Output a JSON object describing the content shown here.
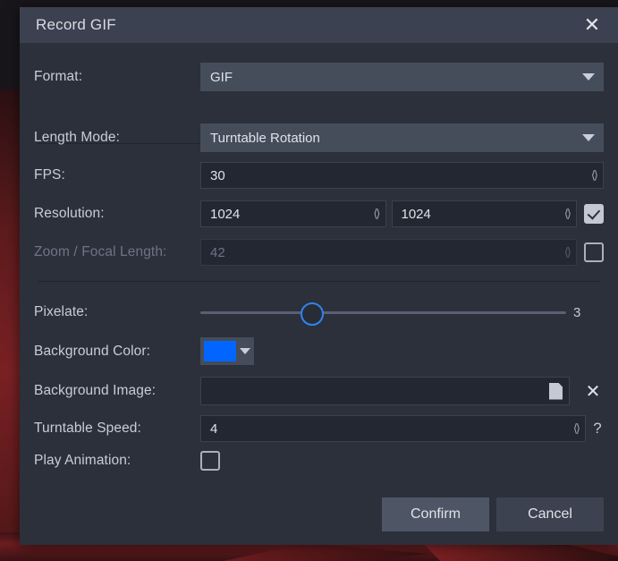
{
  "dialog": {
    "title": "Record GIF",
    "close_icon": "close-icon"
  },
  "rows": {
    "format": {
      "label": "Format:",
      "value": "GIF",
      "options": [
        "GIF"
      ]
    },
    "length_mode": {
      "label": "Length Mode:",
      "value": "Turntable Rotation",
      "options": [
        "Turntable Rotation"
      ]
    },
    "fps": {
      "label": "FPS:",
      "value": "30"
    },
    "resolution": {
      "label": "Resolution:",
      "width": "1024",
      "height": "1024",
      "locked": true
    },
    "zoom_focal": {
      "label": "Zoom / Focal Length:",
      "value": "42",
      "enabled": false,
      "checked": false
    },
    "pixelate": {
      "label": "Pixelate:",
      "value": "3",
      "min": 0,
      "max": 10,
      "percent": 30
    },
    "background_color": {
      "label": "Background Color:",
      "color": "#0066FF"
    },
    "background_image": {
      "label": "Background Image:",
      "value": "",
      "browse_icon": "file-icon",
      "clear_icon": "close-icon"
    },
    "turntable_speed": {
      "label": "Turntable Speed:",
      "value": "4",
      "help_icon": "question-mark-icon"
    },
    "play_animation": {
      "label": "Play Animation:",
      "checked": false
    }
  },
  "footer": {
    "confirm": "Confirm",
    "cancel": "Cancel"
  }
}
